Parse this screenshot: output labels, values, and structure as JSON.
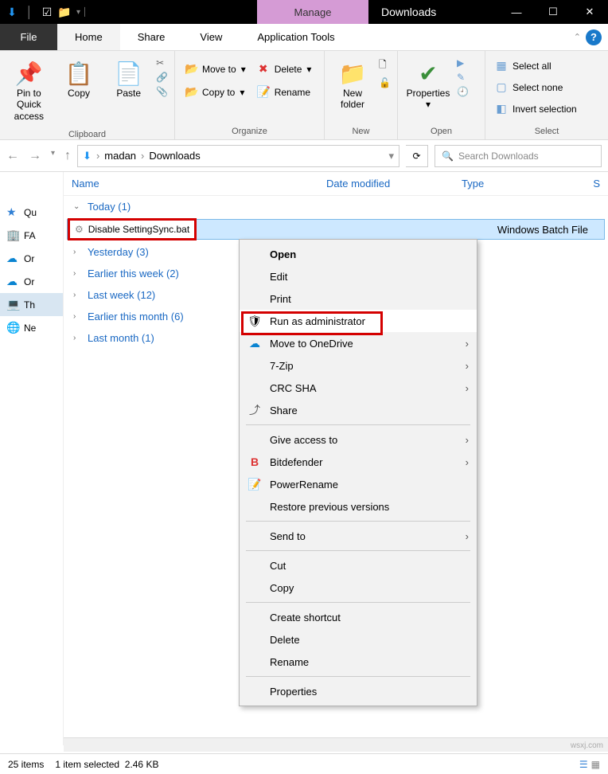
{
  "titlebar": {
    "manage": "Manage",
    "title": "Downloads"
  },
  "tabs": {
    "file": "File",
    "home": "Home",
    "share": "Share",
    "view": "View",
    "apptools": "Application Tools"
  },
  "ribbon": {
    "clipboard": {
      "label": "Clipboard",
      "pin": "Pin to Quick access",
      "copy": "Copy",
      "paste": "Paste"
    },
    "organize": {
      "label": "Organize",
      "moveto": "Move to",
      "copyto": "Copy to",
      "delete": "Delete",
      "rename": "Rename"
    },
    "new": {
      "label": "New",
      "newfolder": "New folder"
    },
    "open": {
      "label": "Open",
      "properties": "Properties"
    },
    "select": {
      "label": "Select",
      "all": "Select all",
      "none": "Select none",
      "invert": "Invert selection"
    }
  },
  "address": {
    "seg1": "madan",
    "seg2": "Downloads",
    "search_placeholder": "Search Downloads"
  },
  "columns": {
    "name": "Name",
    "date": "Date modified",
    "type": "Type",
    "size": "S"
  },
  "nav": {
    "qu": "Qu",
    "fa": "FA",
    "or1": "Or",
    "or2": "Or",
    "th": "Th",
    "ne": "Ne"
  },
  "groups": {
    "today": "Today (1)",
    "yesterday": "Yesterday (3)",
    "thisweek": "Earlier this week (2)",
    "lastweek": "Last week (12)",
    "thismonth": "Earlier this month (6)",
    "lastmonth": "Last month (1)"
  },
  "file": {
    "name": "Disable SettingSync.bat",
    "type": "Windows Batch File"
  },
  "context": {
    "open": "Open",
    "edit": "Edit",
    "print": "Print",
    "runadmin": "Run as administrator",
    "onedrive": "Move to OneDrive",
    "sevenzip": "7-Zip",
    "crcsha": "CRC SHA",
    "share": "Share",
    "access": "Give access to",
    "bitdef": "Bitdefender",
    "powerrename": "PowerRename",
    "restore": "Restore previous versions",
    "sendto": "Send to",
    "cut": "Cut",
    "copy": "Copy",
    "shortcut": "Create shortcut",
    "delete": "Delete",
    "rename": "Rename",
    "properties": "Properties"
  },
  "status": {
    "items": "25 items",
    "selected": "1 item selected",
    "size": "2.46 KB"
  },
  "watermark": "wsxj.com"
}
